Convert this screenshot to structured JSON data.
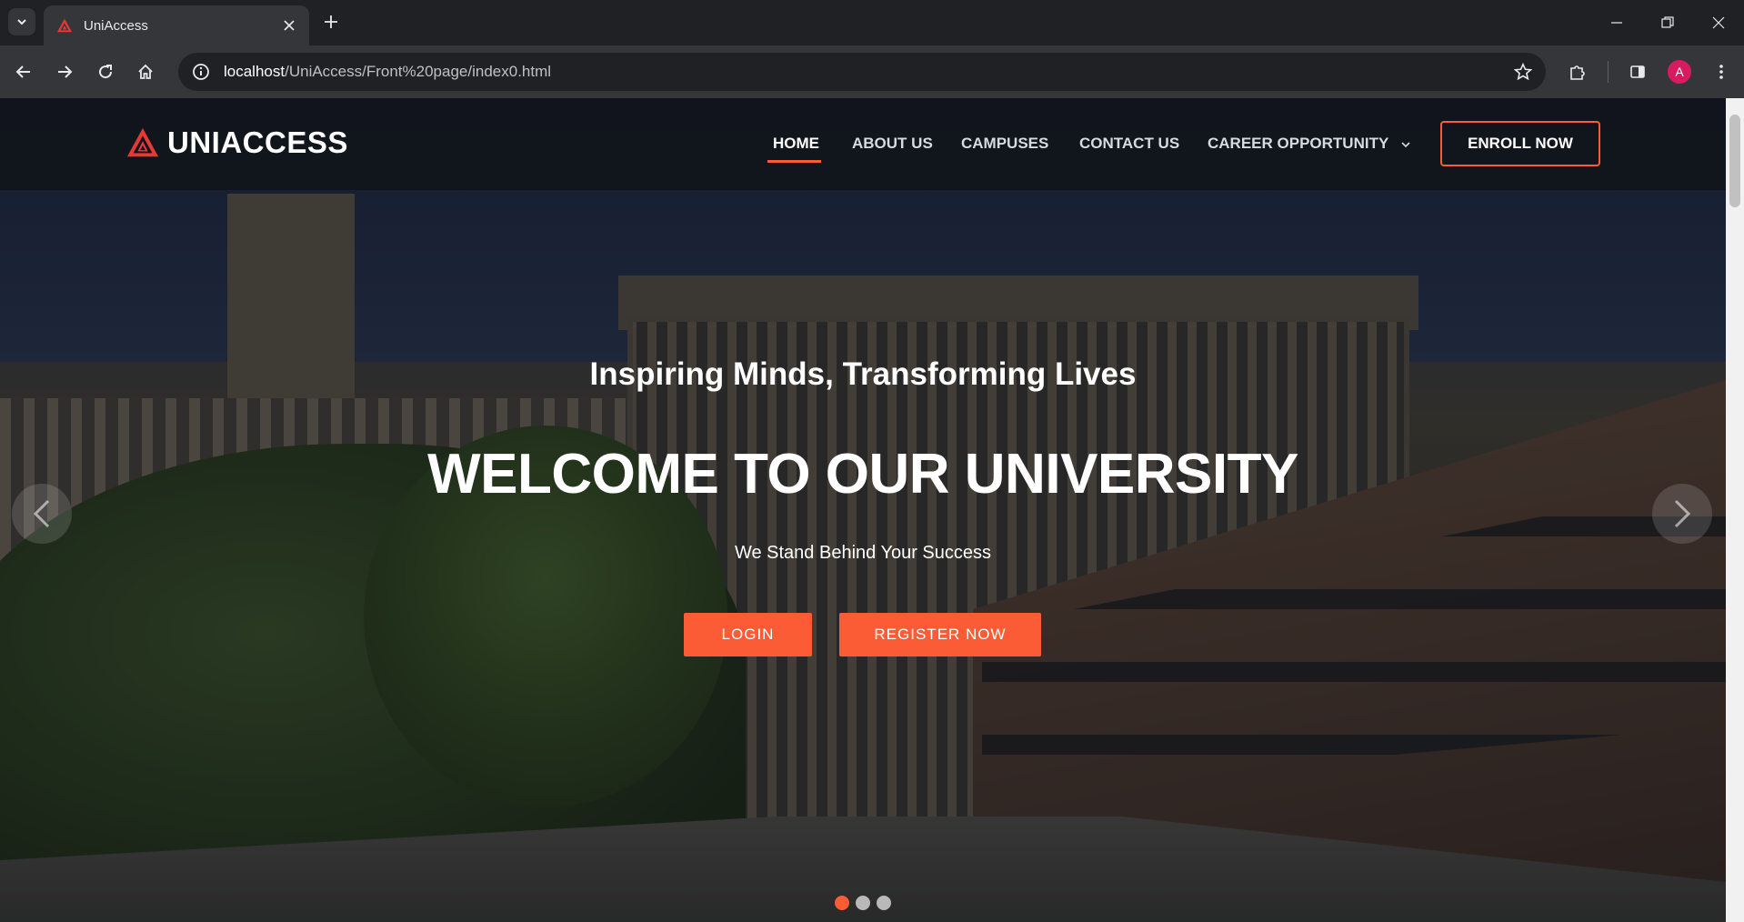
{
  "browser": {
    "tab_title": "UniAccess",
    "url_host": "localhost",
    "url_path": "/UniAccess/Front%20page/index0.html",
    "profile_initial": "A"
  },
  "site": {
    "brand": "UNIACCESS",
    "nav": {
      "home": "HOME",
      "about": "ABOUT US",
      "campuses": "CAMPUSES",
      "contact": "CONTACT US",
      "career": "CAREER OPPORTUNITY"
    },
    "enroll_label": "ENROLL NOW"
  },
  "hero": {
    "subtitle": "Inspiring Minds, Transforming Lives",
    "title": "WELCOME TO OUR UNIVERSITY",
    "tagline": "We Stand Behind Your Success",
    "login_label": "LOGIN",
    "register_label": "REGISTER NOW",
    "slide_active": 1,
    "slide_count": 3
  },
  "colors": {
    "accent": "#fb5b35",
    "chrome_dark": "#202124",
    "chrome_toolbar": "#35363a"
  }
}
